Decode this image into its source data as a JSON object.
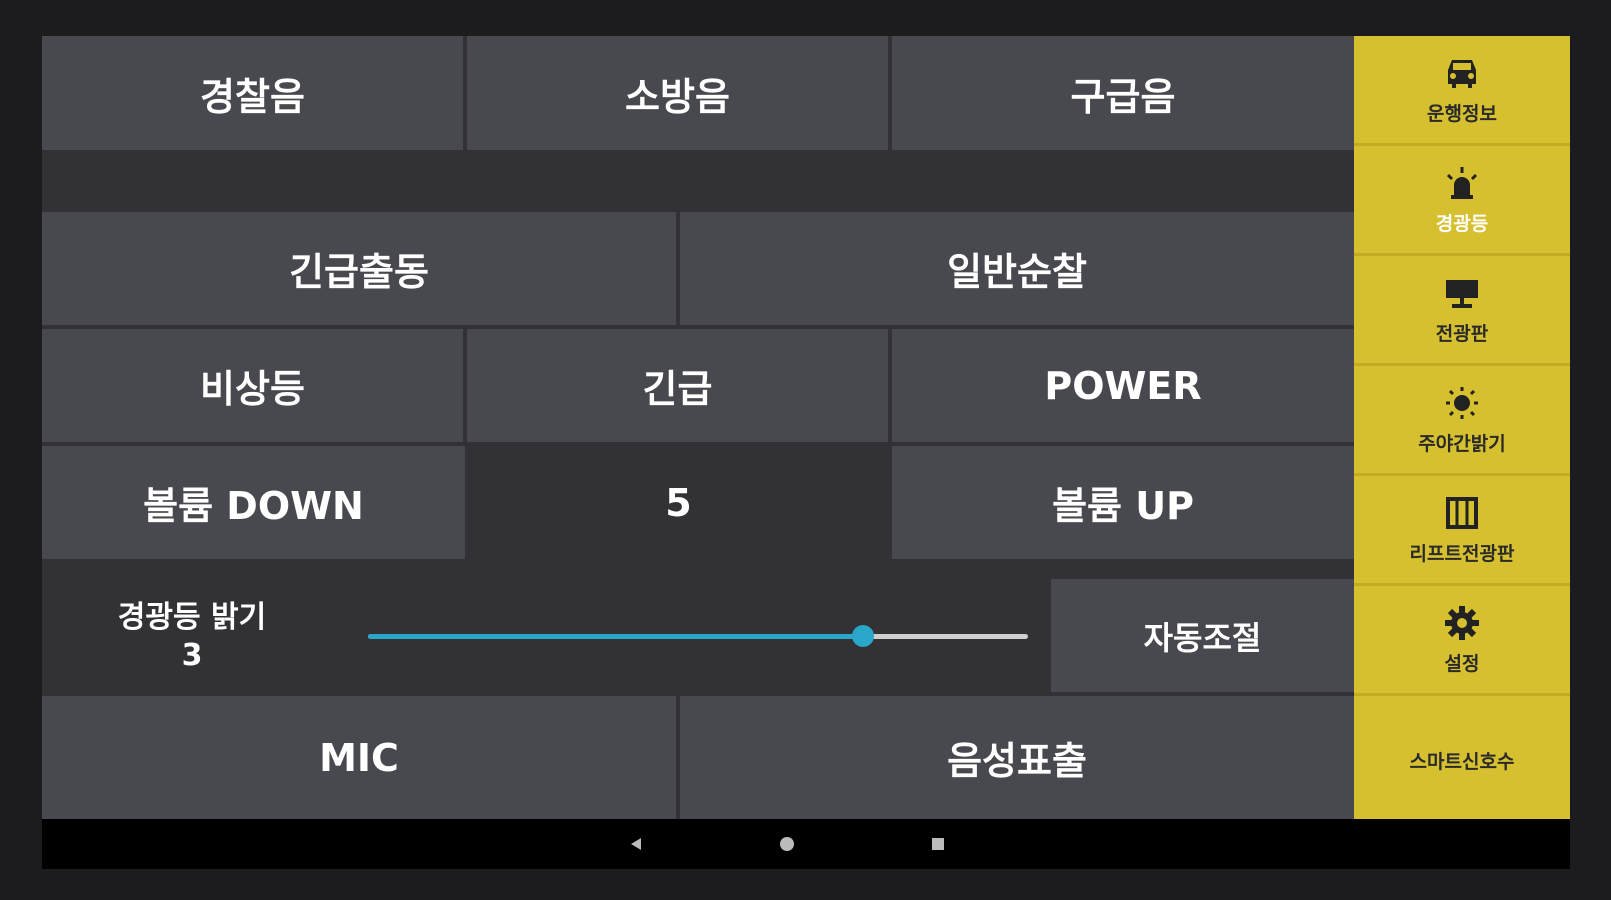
{
  "sound_buttons": [
    "경찰음",
    "소방음",
    "구급음"
  ],
  "mode_buttons": [
    "긴급출동",
    "일반순찰"
  ],
  "light_buttons": [
    "비상등",
    "긴급",
    "POWER"
  ],
  "volume": {
    "down_label": "볼륨 DOWN",
    "value": "5",
    "up_label": "볼륨 UP"
  },
  "brightness": {
    "label": "경광등 밝기",
    "value": "3",
    "fraction": 0.75,
    "auto_label": "자동조절"
  },
  "bottom_buttons": [
    "MIC",
    "음성표출"
  ],
  "sidebar": {
    "items": [
      {
        "label": "운행정보",
        "icon": "car-icon",
        "active": false
      },
      {
        "label": "경광등",
        "icon": "siren-icon",
        "active": true
      },
      {
        "label": "전광판",
        "icon": "display-board-icon",
        "active": false
      },
      {
        "label": "주야간밝기",
        "icon": "brightness-icon",
        "active": false
      },
      {
        "label": "리프트전광판",
        "icon": "lift-board-icon",
        "active": false
      },
      {
        "label": "설정",
        "icon": "gear-icon",
        "active": false
      },
      {
        "label": "스마트신호수",
        "icon": "",
        "active": false
      }
    ]
  },
  "colors": {
    "accent": "#d7c02f",
    "slider": "#2aa6c9",
    "button": "#48484f",
    "background": "#323236"
  }
}
